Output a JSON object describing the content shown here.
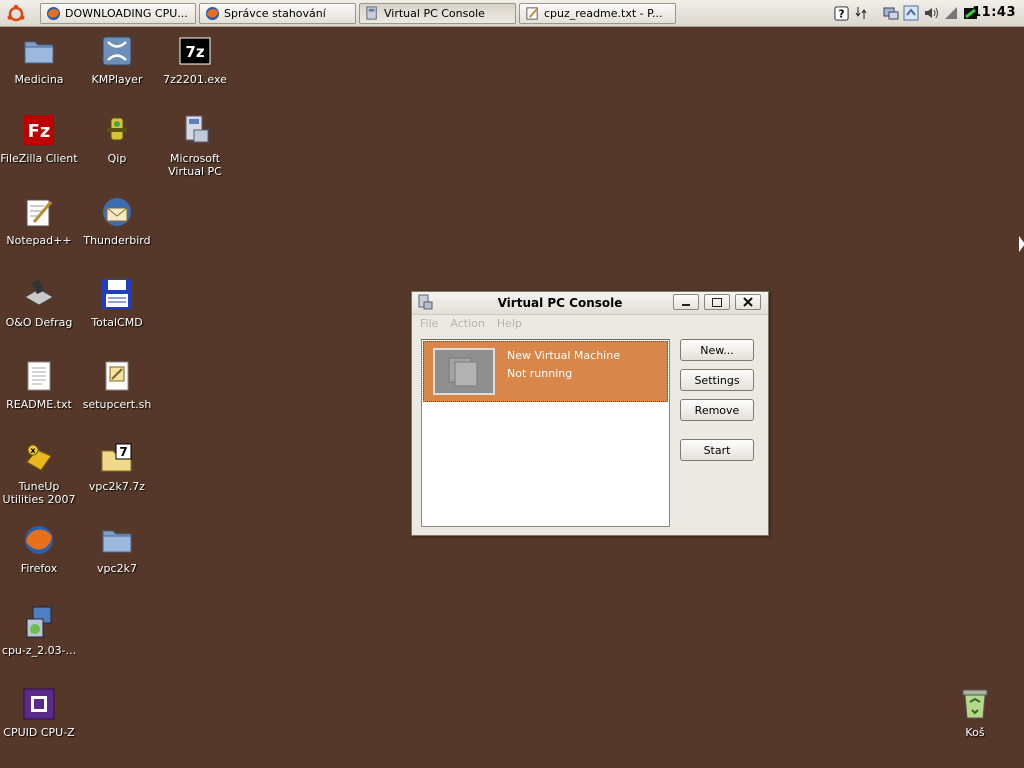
{
  "taskbar": {
    "tasks": [
      {
        "label": "DOWNLOADING CPU...",
        "icon": "firefox-icon",
        "active": false
      },
      {
        "label": "Správce stahování",
        "icon": "firefox-icon",
        "active": false
      },
      {
        "label": "Virtual PC Console",
        "icon": "virtual-pc-icon",
        "active": true
      },
      {
        "label": "cpuz_readme.txt - P...",
        "icon": "notepad-icon",
        "active": false
      }
    ],
    "clock": "11:43"
  },
  "desktop": {
    "icons": [
      {
        "label": "Medicina",
        "icon": "folder-icon"
      },
      {
        "label": "KMPlayer",
        "icon": "kmplayer-icon"
      },
      {
        "label": "7z2201.exe",
        "icon": "sevenzip-icon"
      },
      {
        "label": "FileZilla Client",
        "icon": "filezilla-icon"
      },
      {
        "label": "Qip",
        "icon": "qip-icon"
      },
      {
        "label": "Microsoft Virtual PC",
        "icon": "virtual-pc-icon"
      },
      {
        "label": "Notepad++",
        "icon": "notepad-icon"
      },
      {
        "label": "Thunderbird",
        "icon": "thunderbird-icon"
      },
      {
        "label": "O&O Defrag",
        "icon": "defrag-icon"
      },
      {
        "label": "TotalCMD",
        "icon": "floppy-icon"
      },
      {
        "label": "README.txt",
        "icon": "text-file-icon"
      },
      {
        "label": "setupcert.sh",
        "icon": "script-icon"
      },
      {
        "label": "TuneUp Utilities 2007",
        "icon": "tuneup-icon"
      },
      {
        "label": "vpc2k7.7z",
        "icon": "archive-folder-icon"
      },
      {
        "label": "Firefox",
        "icon": "firefox-icon"
      },
      {
        "label": "vpc2k7",
        "icon": "folder-icon"
      },
      {
        "label": "cpu-z_2.03-...",
        "icon": "installer-icon"
      },
      {
        "label": "CPUID CPU-Z",
        "icon": "cpuz-icon"
      },
      {
        "label": "Koš",
        "icon": "recycle-bin-icon"
      }
    ]
  },
  "window": {
    "title": "Virtual PC Console",
    "menu": [
      "File",
      "Action",
      "Help"
    ],
    "vm": {
      "name": "New Virtual Machine",
      "status": "Not running"
    },
    "buttons": {
      "new": "New...",
      "settings": "Settings",
      "remove": "Remove",
      "start": "Start"
    }
  },
  "colors": {
    "desktop": "#553829",
    "selection": "#d8864a"
  }
}
